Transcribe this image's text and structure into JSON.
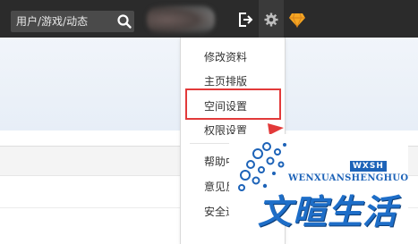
{
  "header": {
    "search_placeholder": "用户/游戏/动态"
  },
  "menu": {
    "items": [
      {
        "label": "修改资料"
      },
      {
        "label": "主页排版"
      },
      {
        "label": "空间设置"
      },
      {
        "label": "权限设置"
      },
      {
        "label": "帮助中心"
      },
      {
        "label": "意见反馈"
      },
      {
        "label": "安全退出"
      }
    ],
    "highlighted_index": 2
  },
  "watermark": {
    "badge": "WXSH",
    "pinyin": "WENXUANSHENGHUO",
    "chinese": "文暄生活"
  },
  "colors": {
    "topbar": "#2b2b2b",
    "highlight": "#e23a3a",
    "brand_blue": "#1e6ec8",
    "diamond": "#f5a623"
  },
  "icons": [
    "search-icon",
    "logout-icon",
    "gear-icon",
    "diamond-icon",
    "arrow-icon"
  ]
}
